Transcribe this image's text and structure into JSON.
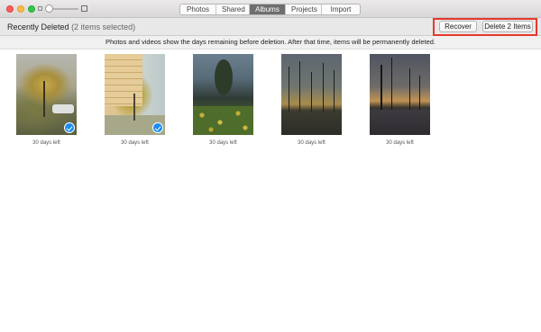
{
  "window": {
    "tabs": [
      {
        "label": "Photos",
        "active": false
      },
      {
        "label": "Shared",
        "active": false
      },
      {
        "label": "Albums",
        "active": true
      },
      {
        "label": "Projects",
        "active": false
      },
      {
        "label": "Import",
        "active": false
      }
    ]
  },
  "toolbar": {
    "album_title": "Recently Deleted",
    "selection_info": "(2 items selected)",
    "recover_label": "Recover",
    "delete_label": "Delete 2 Items",
    "highlight_color": "#e6382c"
  },
  "notice": {
    "text": "Photos and videos show the days remaining before deletion. After that time, items will be permanently deleted."
  },
  "photos": [
    {
      "caption": "30 days left",
      "selected": true
    },
    {
      "caption": "30 days left",
      "selected": true
    },
    {
      "caption": "30 days left",
      "selected": false
    },
    {
      "caption": "30 days left",
      "selected": false
    },
    {
      "caption": "30 days left",
      "selected": false
    }
  ],
  "colors": {
    "selection_check": "#1a8cf0",
    "active_tab": "#6e6e6e"
  }
}
